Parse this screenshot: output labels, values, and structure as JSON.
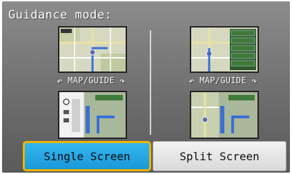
{
  "title": "Guidance mode:",
  "panels": {
    "single": {
      "caption": "MAP/GUIDE"
    },
    "split": {
      "caption": "MAP/GUIDE"
    }
  },
  "arrows": {
    "left": "↶",
    "right": "↷"
  },
  "buttons": {
    "single": "Single Screen",
    "split": "Split Screen"
  },
  "colors": {
    "selected_fill": "#1a98d8",
    "selected_border": "#f0b400",
    "unselected_fill": "#e6e6e6",
    "background": "#7a7a7a"
  }
}
